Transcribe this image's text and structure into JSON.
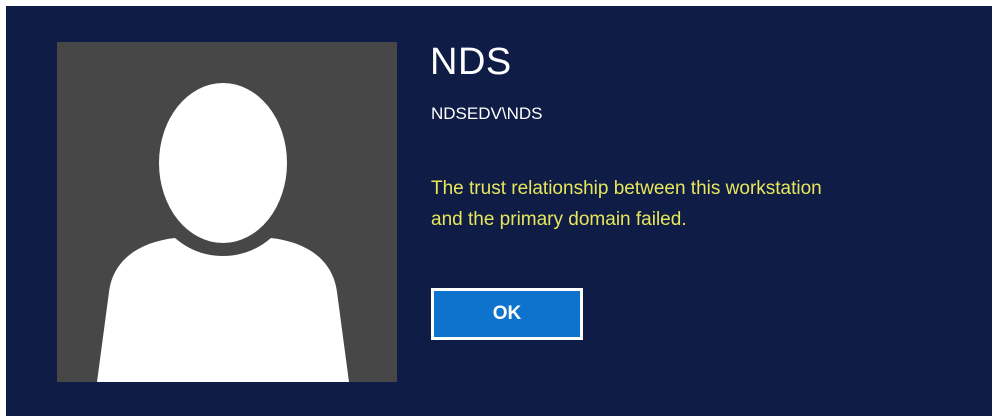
{
  "user": {
    "display_name": "NDS",
    "account": "NDSEDV\\NDS"
  },
  "message": {
    "line1": "The trust relationship between this workstation",
    "line2": "and the primary domain failed."
  },
  "actions": {
    "ok_label": "OK"
  },
  "icons": {
    "avatar": "default-user-silhouette-icon"
  },
  "colors": {
    "background": "#0e1c46",
    "avatar_tile": "#474747",
    "message_text": "#e8e65a",
    "button": "#0d73cc"
  }
}
